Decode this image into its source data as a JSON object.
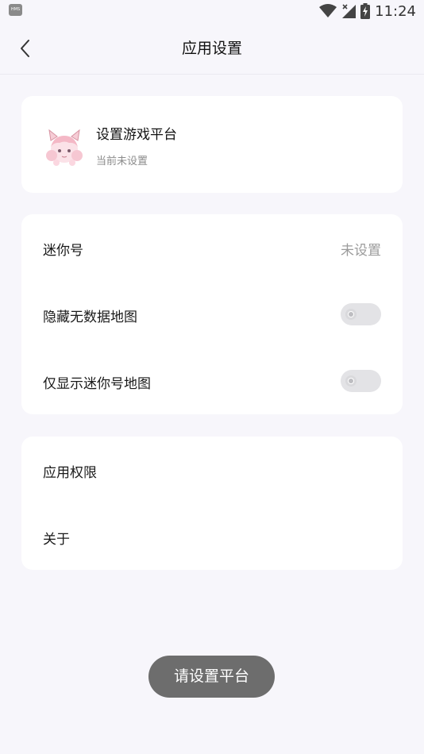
{
  "status_bar": {
    "app_icon_text": "HMS",
    "time": "11:24",
    "icons": [
      "wifi-icon",
      "signal-icon",
      "battery-charging-icon"
    ]
  },
  "header": {
    "back_icon": "chevron-left-icon",
    "title": "应用设置"
  },
  "platform_card": {
    "title": "设置游戏平台",
    "subtitle": "当前未设置"
  },
  "settings": {
    "mini_id": {
      "label": "迷你号",
      "value": "未设置"
    },
    "hide_no_data_maps": {
      "label": "隐藏无数据地图",
      "enabled": false
    },
    "only_mini_id_maps": {
      "label": "仅显示迷你号地图",
      "enabled": false
    }
  },
  "more": {
    "permissions": {
      "label": "应用权限"
    },
    "about": {
      "label": "关于"
    }
  },
  "toast": {
    "text": "请设置平台"
  }
}
